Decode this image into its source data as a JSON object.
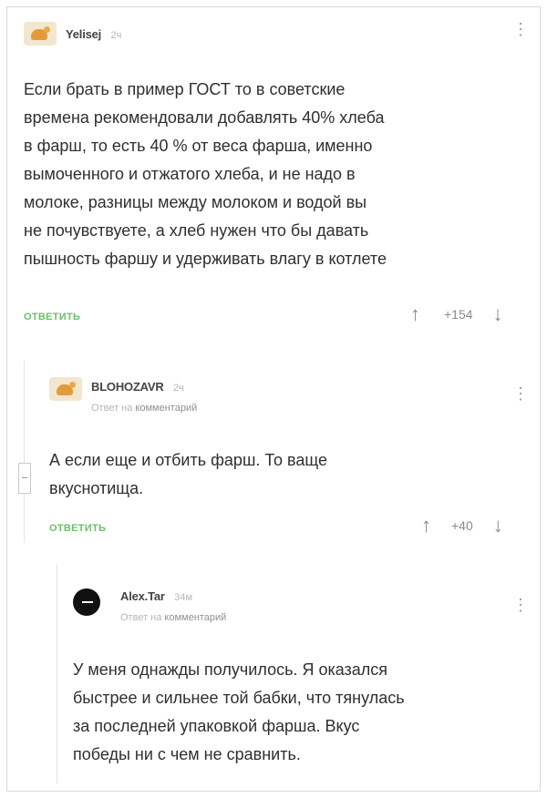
{
  "comments": [
    {
      "author": "Yelisej",
      "time": "2ч",
      "text": "Если брать в пример ГОСТ то в советские\nвремена рекомендовали добавлять 40% хлеба\nв фарш, то есть 40 % от веса фарша, именно\nвымоченного и отжатого хлеба, и не надо в\nмолоке, разницы между молоком и водой вы\nне почувствуете, а хлеб нужен что бы давать\nпышность фаршу и удерживать влагу в котлете",
      "reply_label": "ОТВЕТИТЬ",
      "rating": "+154"
    },
    {
      "author": "BLOHOZAVR",
      "time": "2ч",
      "reply_to_prefix": "Ответ на",
      "reply_to_link": "комментарий",
      "text": "А если еще и отбить фарш. То ваще\nвкуснотища.",
      "reply_label": "ОТВЕТИТЬ",
      "rating": "+40"
    },
    {
      "author": "Alex.Tar",
      "time": "34м",
      "reply_to_prefix": "Ответ на",
      "reply_to_link": "комментарий",
      "text": "У меня однажды получилось. Я оказался\nбыстрее и сильнее той бабки, что тянулась\nза последней упаковкой фарша. Вкус\nпобеды ни с чем не сравнить."
    }
  ],
  "icons": {
    "menu": "more-vertical-icon",
    "upvote": "arrow-up-icon",
    "downvote": "arrow-down-icon"
  },
  "colors": {
    "reply": "#6bc06a",
    "muted": "#b5b5b5"
  }
}
